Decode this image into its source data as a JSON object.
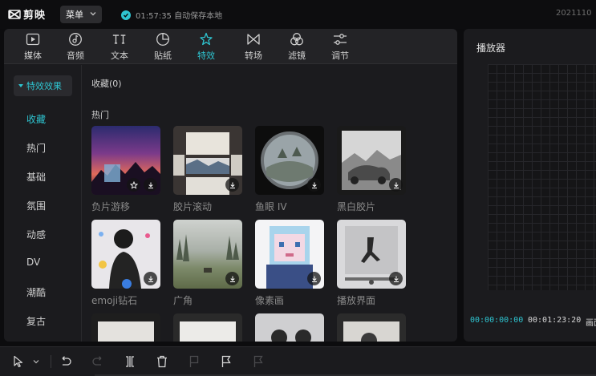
{
  "app": {
    "name": "剪映"
  },
  "topbar": {
    "menu_label": "菜单",
    "save_status": "01:57:35 自动保存本地",
    "date": "2021110"
  },
  "toolbar": {
    "items": [
      {
        "label": "媒体",
        "icon": "media-icon"
      },
      {
        "label": "音频",
        "icon": "audio-icon"
      },
      {
        "label": "文本",
        "icon": "text-icon"
      },
      {
        "label": "贴纸",
        "icon": "sticker-icon"
      },
      {
        "label": "特效",
        "icon": "effects-icon",
        "active": true
      },
      {
        "label": "转场",
        "icon": "transition-icon"
      },
      {
        "label": "滤镜",
        "icon": "filter-icon"
      },
      {
        "label": "调节",
        "icon": "adjust-icon"
      }
    ]
  },
  "sidebar": {
    "header": "特效效果",
    "items": [
      {
        "label": "收藏",
        "active": true
      },
      {
        "label": "热门"
      },
      {
        "label": "基础"
      },
      {
        "label": "氛围"
      },
      {
        "label": "动感"
      },
      {
        "label": "DV"
      },
      {
        "label": "潮酷"
      },
      {
        "label": "复古"
      }
    ]
  },
  "content": {
    "favorites_title": "收藏(0)",
    "hot_title": "热门",
    "tiles": [
      {
        "label": "负片游移"
      },
      {
        "label": "胶片滚动"
      },
      {
        "label": "鱼眼 IV"
      },
      {
        "label": "黑白胶片"
      },
      {
        "label": "emoji钻石"
      },
      {
        "label": "广角"
      },
      {
        "label": "像素画"
      },
      {
        "label": "播放界面"
      }
    ]
  },
  "player": {
    "title": "播放器",
    "current_time": "00:00:00:00",
    "total_time": "00:01:23:20",
    "extra": "画面"
  },
  "colors": {
    "accent": "#2ec4d0",
    "panel": "#1b1b1e",
    "background": "#0c0c0e"
  }
}
